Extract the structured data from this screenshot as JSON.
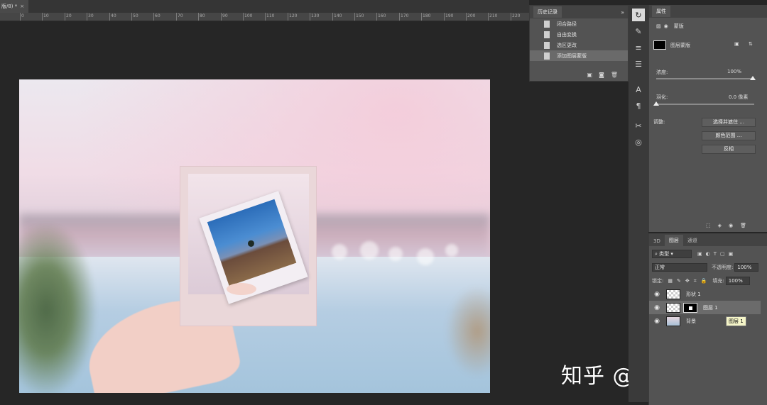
{
  "document": {
    "tab_title": "版/8) *",
    "close_glyph": "×"
  },
  "ruler": {
    "labels": [
      "0",
      "10",
      "20",
      "30",
      "40",
      "50",
      "60",
      "70",
      "80",
      "90",
      "100",
      "110",
      "120",
      "130",
      "140",
      "150",
      "160",
      "170",
      "180",
      "190",
      "200",
      "210",
      "220"
    ]
  },
  "history": {
    "title": "历史记录",
    "menu_glyph": "»",
    "items": [
      {
        "label": "闭合路径"
      },
      {
        "label": "自由变换"
      },
      {
        "label": "选区更改"
      },
      {
        "label": "添加图层蒙版"
      }
    ],
    "active_index": 3
  },
  "properties": {
    "title": "属性",
    "mask_type_label": "蒙版",
    "layer_mask_label": "图层蒙版",
    "density_label": "浓度:",
    "density_value": "100%",
    "feather_label": "羽化:",
    "feather_value": "0.0 像素",
    "adjust_label": "调整:",
    "select_and_mask": "选择并遮住 ...",
    "color_range": "颜色范围 ...",
    "invert": "反相"
  },
  "layers_panel": {
    "tabs": [
      "3D",
      "图层",
      "通道"
    ],
    "active_tab": 1,
    "filter_kind": "类型",
    "blend_mode": "正常",
    "opacity_label": "不透明度:",
    "opacity_value": "100%",
    "lock_label": "锁定:",
    "fill_label": "填充:",
    "fill_value": "100%",
    "layers": [
      {
        "name": "形状 1",
        "selected": false
      },
      {
        "name": "图层 1",
        "selected": true
      },
      {
        "name": "背景",
        "selected": false
      }
    ],
    "tooltip": "图层 1"
  },
  "watermark": "知乎 @妮可爱设计"
}
